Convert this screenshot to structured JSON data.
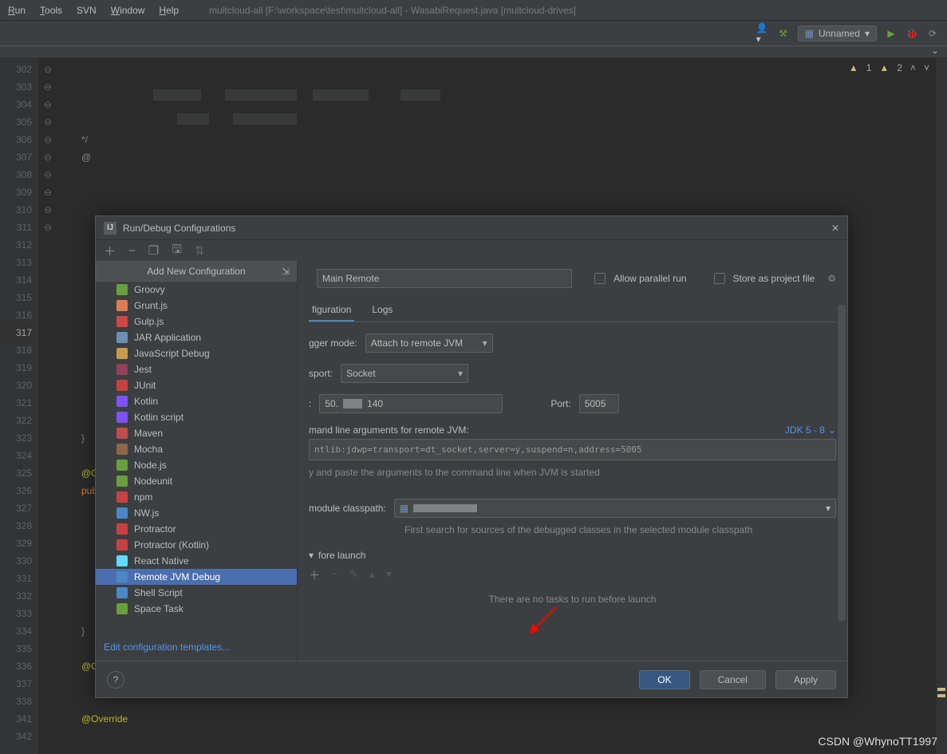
{
  "window": {
    "title": "multcloud-all [F:\\workspace\\test\\multcloud-all] - WasabiRequest.java [multcloud-drives]"
  },
  "menubar": {
    "run": "Run",
    "tools": "Tools",
    "svn": "SVN",
    "window": "Window",
    "help": "Help"
  },
  "toolbar": {
    "run_config": "Unnamed"
  },
  "editor": {
    "warn1_count": "1",
    "warn2_count": "2",
    "lines": [
      "302",
      "303",
      "304",
      "305",
      "306",
      "307",
      "308",
      "309",
      "310",
      "311",
      "312",
      "313",
      "314",
      "315",
      "316",
      "317",
      "318",
      "319",
      "320",
      "321",
      "322",
      "323",
      "324",
      "325",
      "326",
      "327",
      "328",
      "329",
      "330",
      "331",
      "332",
      "333",
      "334",
      "335",
      "336",
      "337",
      "338",
      "341",
      "342"
    ],
    "comment_open": "*/",
    "override": "@Override",
    "override2": "@Ov",
    "rbrace": "}",
    "pub": "pub"
  },
  "dialog": {
    "title": "Run/Debug Configurations",
    "add_new": "Add New Configuration",
    "items": [
      {
        "label": "Groovy",
        "color": "#6a9e3e"
      },
      {
        "label": "Grunt.js",
        "color": "#e07b53"
      },
      {
        "label": "Gulp.js",
        "color": "#cf4647"
      },
      {
        "label": "JAR Application",
        "color": "#6e8fb5"
      },
      {
        "label": "JavaScript Debug",
        "color": "#c79b4b"
      },
      {
        "label": "Jest",
        "color": "#944058"
      },
      {
        "label": "JUnit",
        "color": "#c9413f"
      },
      {
        "label": "Kotlin",
        "color": "#7f52ff"
      },
      {
        "label": "Kotlin script",
        "color": "#7f52ff"
      },
      {
        "label": "Maven",
        "color": "#c04b4b"
      },
      {
        "label": "Mocha",
        "color": "#8d6748"
      },
      {
        "label": "Node.js",
        "color": "#6a9e3e"
      },
      {
        "label": "Nodeunit",
        "color": "#6a9e3e"
      },
      {
        "label": "npm",
        "color": "#c9413f"
      },
      {
        "label": "NW.js",
        "color": "#4a88c7"
      },
      {
        "label": "Protractor",
        "color": "#c9413f"
      },
      {
        "label": "Protractor (Kotlin)",
        "color": "#c9413f"
      },
      {
        "label": "React Native",
        "color": "#61dafb"
      },
      {
        "label": "Remote JVM Debug",
        "color": "#4a88c7"
      },
      {
        "label": "Shell Script",
        "color": "#4a88c7"
      },
      {
        "label": "Space Task",
        "color": "#6a9e3e"
      }
    ],
    "selected_index": 18,
    "edit_templates": "Edit configuration templates...",
    "right": {
      "name_label": "",
      "name_value": "Main Remote",
      "allow_parallel": "Allow parallel run",
      "store_project": "Store as project file",
      "tab_config": "figuration",
      "tab_logs": "Logs",
      "debugger_mode_label": "gger mode:",
      "debugger_mode_value": "Attach to remote JVM",
      "transport_label": "sport:",
      "transport_value": "Socket",
      "host_label": ":",
      "host_value_a": "50.",
      "host_value_b": "140",
      "port_label": "Port:",
      "port_value": "5005",
      "cmd_label": "mand line arguments for remote JVM:",
      "jdk_link": "JDK 5 - 8",
      "cmd_value": "ntlib:jdwp=transport=dt_socket,server=y,suspend=n,address=5005",
      "cmd_hint": "y and paste the arguments to the command line when JVM is started",
      "module_label": "module classpath:",
      "module_hint": "First search for sources of the debugged classes in the selected module classpath",
      "before_launch": "fore launch",
      "bl_empty": "There are no tasks to run before launch"
    },
    "footer": {
      "help": "?",
      "ok": "OK",
      "cancel": "Cancel",
      "apply": "Apply"
    }
  },
  "watermark": "CSDN @WhynoTT1997"
}
